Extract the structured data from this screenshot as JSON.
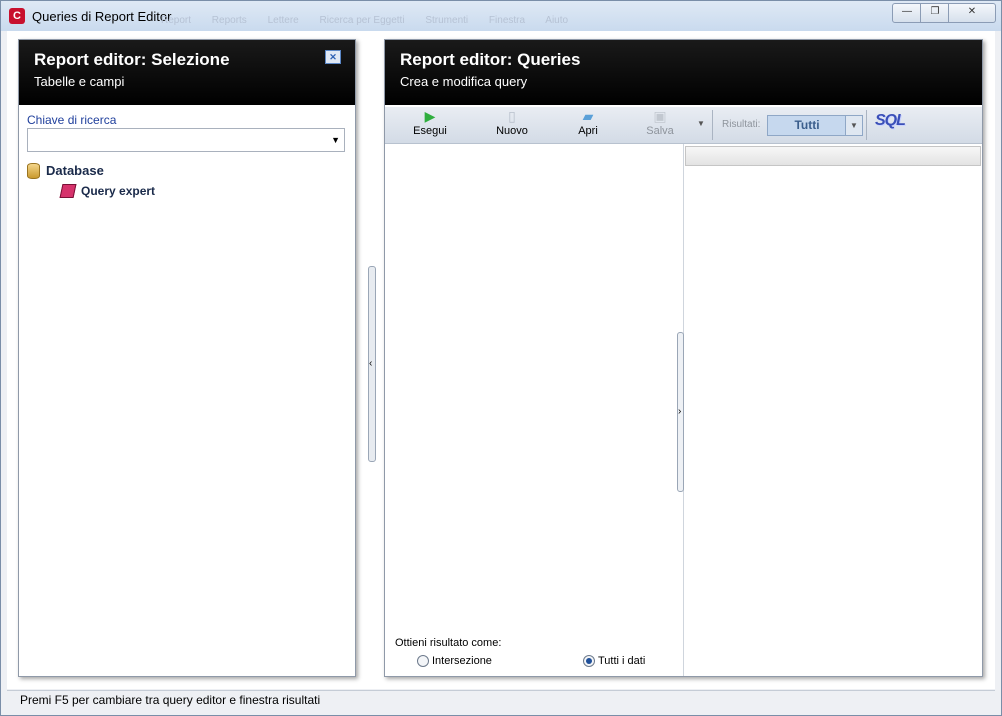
{
  "window": {
    "title": "Queries di Report Editor",
    "app_icon_glyph": "C",
    "ghost_menu": [
      "Report",
      "Reports",
      "Lettere",
      "Ricerca per Eggetti",
      "Strumenti",
      "Finestra",
      "Aiuto"
    ],
    "controls": {
      "minimize": "—",
      "maximize": "❐",
      "close": "✕"
    }
  },
  "left_panel": {
    "title": "Report editor:  Selezione",
    "subtitle": "Tabelle e campi",
    "header_icon": "x-icon",
    "search": {
      "label": "Chiave di ricerca",
      "value": ""
    },
    "tree": {
      "root": {
        "label": "Database",
        "icon": "database-icon"
      },
      "children": [
        {
          "label": "Query expert",
          "icon": "query-icon"
        }
      ]
    }
  },
  "right_panel": {
    "title": "Report editor: Queries",
    "subtitle": "Crea e modifica query",
    "toolbar": {
      "buttons": [
        {
          "label": "Esegui",
          "icon": "play-icon",
          "enabled": true
        },
        {
          "label": "Nuovo",
          "icon": "new-doc-icon",
          "enabled": true
        },
        {
          "label": "Apri",
          "icon": "open-folder-icon",
          "enabled": true
        },
        {
          "label": "Salva",
          "icon": "save-icon",
          "enabled": false
        }
      ],
      "risultati_label": "Risultati:",
      "risultati_value": "Tutti",
      "sql_logo": "SQL"
    },
    "result_options": {
      "label": "Ottieni risultato come:",
      "options": [
        {
          "label": "Intersezione",
          "checked": false
        },
        {
          "label": "Tutti i dati",
          "checked": true
        }
      ]
    }
  },
  "status_bar": {
    "text": "Premi F5 per cambiare tra query editor e finestra risultati"
  },
  "colors": {
    "header_bg": "#000000",
    "search_label": "#1f3f9c",
    "accent_blue": "#3a4fb8",
    "play_green": "#2fae3e"
  }
}
